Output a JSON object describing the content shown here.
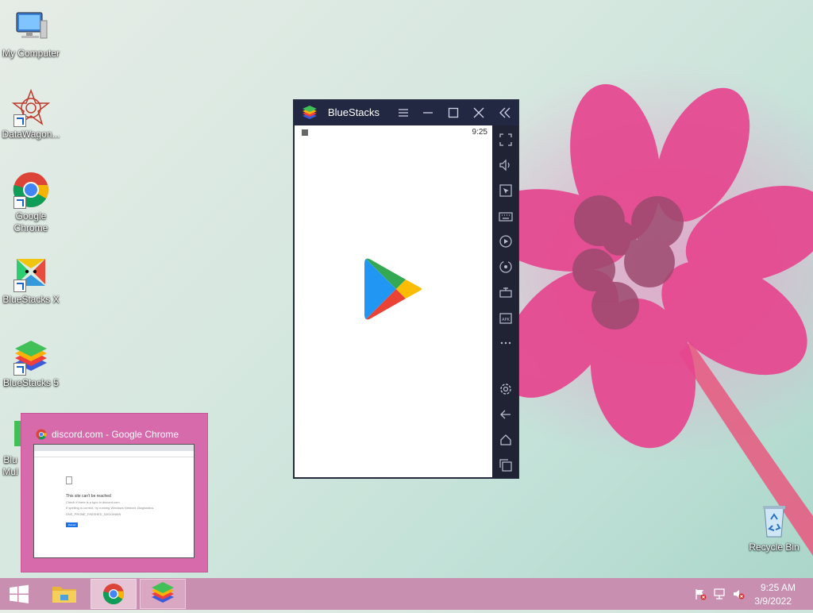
{
  "desktop": {
    "icons": [
      {
        "label": "My Computer",
        "icon": "computer-icon"
      },
      {
        "label": "DataWagon...",
        "icon": "datawagon-icon"
      },
      {
        "label": "Google Chrome",
        "icon": "chrome-icon"
      },
      {
        "label": "BlueStacks X",
        "icon": "bluestacks-x-icon"
      },
      {
        "label": "BlueStacks 5",
        "icon": "bluestacks-5-icon"
      },
      {
        "label": "Blu Mul",
        "icon": "bluestacks-multi-icon"
      },
      {
        "label": "Recycle Bin",
        "icon": "recycle-bin-icon"
      }
    ]
  },
  "bluestacks": {
    "title": "BlueStacks",
    "status_time": "9:25",
    "titlebar_buttons": [
      "menu-icon",
      "minimize-icon",
      "maximize-icon",
      "close-icon",
      "collapse-icon"
    ],
    "sidebar_buttons": [
      "fullscreen-icon",
      "volume-icon",
      "cursor-icon",
      "keyboard-icon",
      "macro-icon",
      "rotate-icon",
      "shake-icon",
      "apk-icon",
      "more-icon",
      "settings-icon",
      "back-icon",
      "home-icon",
      "recents-icon"
    ]
  },
  "thumbnail": {
    "title": "discord.com - Google Chrome",
    "heading": "This site can't be reached",
    "line1": "Check if there is a typo in discord.com",
    "line2": "If spelling is correct, try running Windows Network Diagnostics.",
    "line3": "DNS_PROBE_FINISHED_NXDOMAIN",
    "button": "Reload"
  },
  "taskbar": {
    "time": "9:25 AM",
    "date": "3/9/2022",
    "apps": [
      "file-explorer-icon",
      "chrome-icon",
      "bluestacks-icon"
    ],
    "tray": [
      "action-center-flag-icon",
      "network-icon",
      "volume-muted-icon"
    ]
  },
  "colors": {
    "taskbar": "#c88fb0",
    "bluestacks_chrome": "#232842",
    "thumbnail_bg": "#d66aaa"
  }
}
